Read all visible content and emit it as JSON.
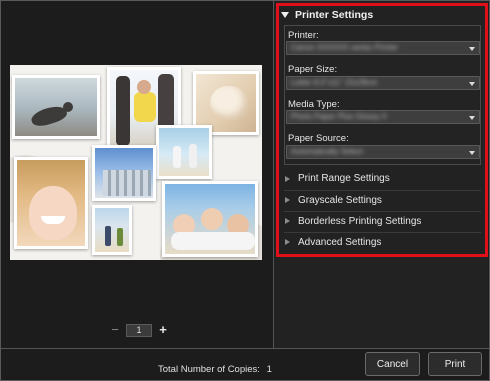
{
  "preview": {
    "page_number": "1",
    "minus_glyph": "−",
    "plus_glyph": "+"
  },
  "printer_settings": {
    "title": "Printer Settings",
    "fields": [
      {
        "label": "Printer:",
        "value": "Canon XXXXXX series Printer"
      },
      {
        "label": "Paper Size:",
        "value": "Letter 8.5\"x11\" 22x28cm"
      },
      {
        "label": "Media Type:",
        "value": "Photo Paper Plus Glossy II"
      },
      {
        "label": "Paper Source:",
        "value": "Automatically Select"
      }
    ]
  },
  "collapsed_sections": [
    {
      "label": "Print Range Settings"
    },
    {
      "label": "Grayscale Settings"
    },
    {
      "label": "Borderless Printing Settings"
    },
    {
      "label": "Advanced Settings"
    }
  ],
  "footer": {
    "copies_label": "Total Number of Copies:",
    "copies_value": "1",
    "cancel_label": "Cancel",
    "print_label": "Print"
  },
  "colors": {
    "highlight": "#e0101a",
    "background": "#1c1c1c"
  },
  "icons": [
    "collapse-triangle-icon",
    "expand-triangle-icon",
    "dropdown-arrow-icon"
  ]
}
